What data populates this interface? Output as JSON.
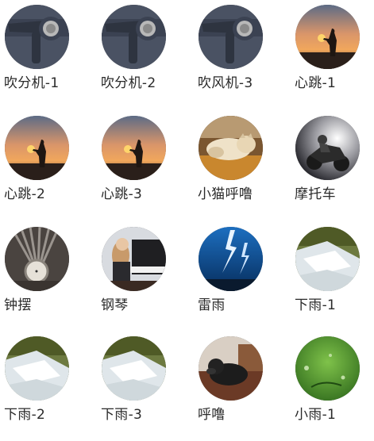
{
  "sounds": [
    {
      "label": "吹分机-1",
      "icon": "hair-dryer-icon"
    },
    {
      "label": "吹分机-2",
      "icon": "hair-dryer-icon"
    },
    {
      "label": "吹风机-3",
      "icon": "hair-dryer-icon"
    },
    {
      "label": "心跳-1",
      "icon": "sunset-silhouette-icon"
    },
    {
      "label": "心跳-2",
      "icon": "sunset-silhouette-icon"
    },
    {
      "label": "心跳-3",
      "icon": "sunset-silhouette-icon"
    },
    {
      "label": "小猫呼噜",
      "icon": "sleeping-cat-icon"
    },
    {
      "label": "摩托车",
      "icon": "motorcycle-icon"
    },
    {
      "label": "钟摆",
      "icon": "pocket-watch-icon"
    },
    {
      "label": "钢琴",
      "icon": "piano-icon"
    },
    {
      "label": "雷雨",
      "icon": "lightning-storm-icon"
    },
    {
      "label": "下雨-1",
      "icon": "waterfall-icon"
    },
    {
      "label": "下雨-2",
      "icon": "waterfall-icon"
    },
    {
      "label": "下雨-3",
      "icon": "waterfall-icon"
    },
    {
      "label": "呼噜",
      "icon": "sleeping-dog-icon"
    },
    {
      "label": "小雨-1",
      "icon": "raindrop-leaf-icon"
    }
  ]
}
